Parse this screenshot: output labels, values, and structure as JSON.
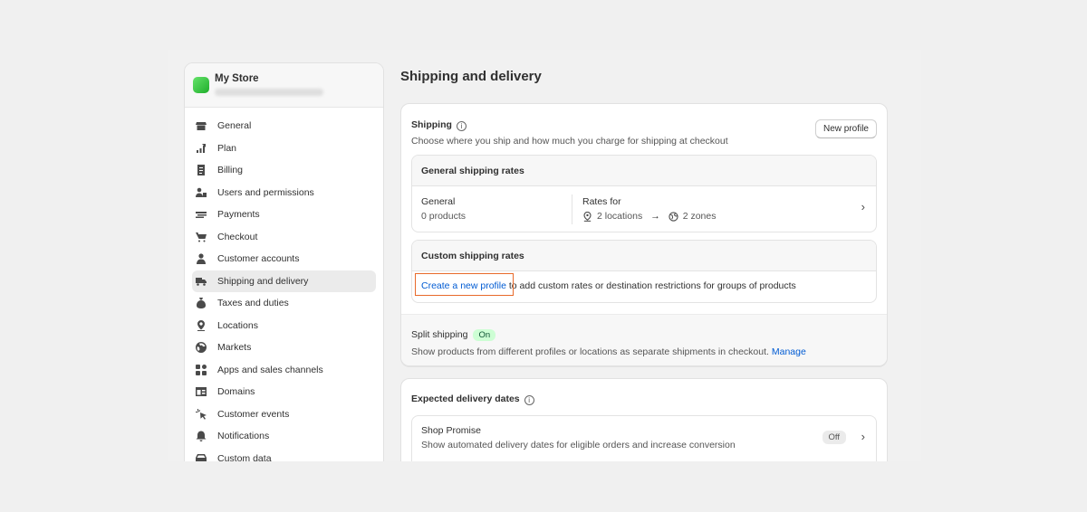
{
  "store": {
    "name": "My Store"
  },
  "sidebar": {
    "items": [
      {
        "label": "General",
        "icon": "store-icon"
      },
      {
        "label": "Plan",
        "icon": "plan-icon"
      },
      {
        "label": "Billing",
        "icon": "billing-icon"
      },
      {
        "label": "Users and permissions",
        "icon": "users-icon"
      },
      {
        "label": "Payments",
        "icon": "payments-icon"
      },
      {
        "label": "Checkout",
        "icon": "cart-icon"
      },
      {
        "label": "Customer accounts",
        "icon": "person-icon"
      },
      {
        "label": "Shipping and delivery",
        "icon": "truck-icon",
        "active": true
      },
      {
        "label": "Taxes and duties",
        "icon": "tax-icon"
      },
      {
        "label": "Locations",
        "icon": "location-icon"
      },
      {
        "label": "Markets",
        "icon": "globe-icon"
      },
      {
        "label": "Apps and sales channels",
        "icon": "apps-icon"
      },
      {
        "label": "Domains",
        "icon": "domain-icon"
      },
      {
        "label": "Customer events",
        "icon": "cursor-icon"
      },
      {
        "label": "Notifications",
        "icon": "bell-icon"
      },
      {
        "label": "Custom data",
        "icon": "data-icon"
      }
    ]
  },
  "page": {
    "title": "Shipping and delivery"
  },
  "shipping": {
    "title": "Shipping",
    "info": "i",
    "description": "Choose where you ship and how much you charge for shipping at checkout",
    "new_profile_label": "New profile",
    "general_rates": {
      "heading": "General shipping rates",
      "profile_name": "General",
      "profile_products": "0 products",
      "rates_for_label": "Rates for",
      "locations": "2 locations",
      "arrow": "→",
      "zones": "2 zones"
    },
    "custom_rates": {
      "heading": "Custom shipping rates",
      "link_text": "Create a new profile",
      "rest_text": " to add custom rates or destination restrictions for groups of products"
    },
    "split": {
      "title": "Split shipping",
      "status": "On",
      "description": "Show products from different profiles or locations as separate shipments in checkout.",
      "manage_label": "Manage"
    }
  },
  "delivery_dates": {
    "title": "Expected delivery dates",
    "info": "i",
    "shop_promise": {
      "title": "Shop Promise",
      "description": "Show automated delivery dates for eligible orders and increase conversion",
      "status": "Off"
    }
  },
  "icons": {
    "chevron": "›"
  },
  "colors": {
    "accent_link": "#005bd3",
    "highlight": "#e86a2a",
    "on_badge": "#cdfed4"
  }
}
